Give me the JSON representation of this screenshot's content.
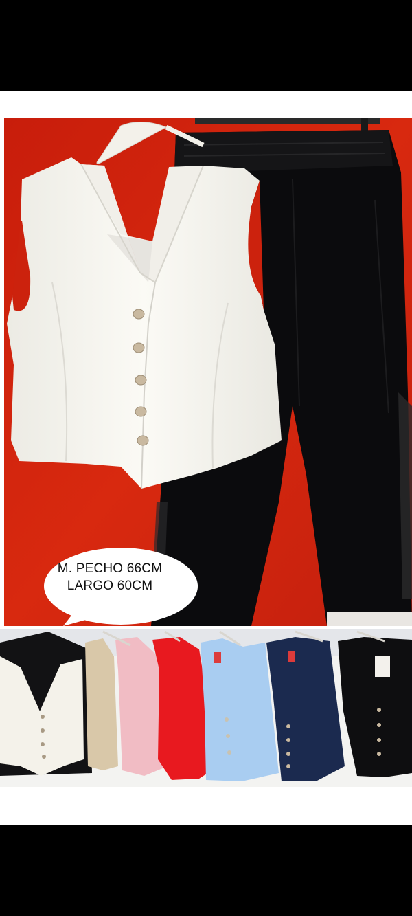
{
  "image": {
    "measurement_bubble": {
      "line1": "M. PECHO 66CM",
      "line2": "LARGO 60CM"
    }
  },
  "colors": {
    "wall_red": "#d4250f",
    "vest_white": "#f7f6f1",
    "trousers_black": "#0b0b0d",
    "button_beige": "#c9b9a0",
    "bottom_vests": [
      "#f4f2ea",
      "#d9c8a9",
      "#f1bcc4",
      "#e8191f",
      "#a9cdf1",
      "#1b2a4f",
      "#0e0e10"
    ]
  },
  "icons": [
    "hanger-icon",
    "speech-bubble-icon",
    "button-icon"
  ]
}
